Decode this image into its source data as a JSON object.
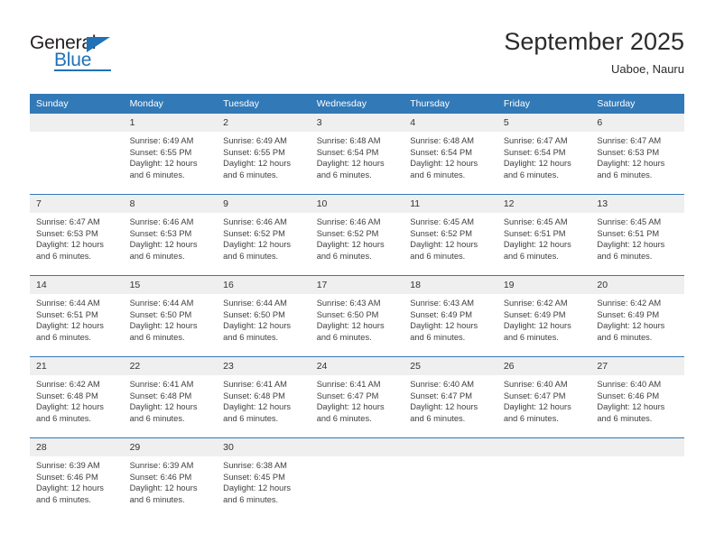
{
  "brand": {
    "name_top": "General",
    "name_bottom": "Blue",
    "logo_icon": "triangle-icon",
    "accent_color": "#1f72b8"
  },
  "header": {
    "title": "September 2025",
    "subtitle": "Uaboe, Nauru"
  },
  "theme": {
    "header_bg": "#3279b7",
    "daynum_bg": "#efefef",
    "rule_color": "#3279b7",
    "text_color": "#404040"
  },
  "calendar": {
    "weekday_headers": [
      "Sunday",
      "Monday",
      "Tuesday",
      "Wednesday",
      "Thursday",
      "Friday",
      "Saturday"
    ],
    "weeks": [
      [
        {
          "date": "",
          "sunrise": "",
          "sunset": "",
          "daylight": ""
        },
        {
          "date": "1",
          "sunrise": "Sunrise: 6:49 AM",
          "sunset": "Sunset: 6:55 PM",
          "daylight": "Daylight: 12 hours and 6 minutes."
        },
        {
          "date": "2",
          "sunrise": "Sunrise: 6:49 AM",
          "sunset": "Sunset: 6:55 PM",
          "daylight": "Daylight: 12 hours and 6 minutes."
        },
        {
          "date": "3",
          "sunrise": "Sunrise: 6:48 AM",
          "sunset": "Sunset: 6:54 PM",
          "daylight": "Daylight: 12 hours and 6 minutes."
        },
        {
          "date": "4",
          "sunrise": "Sunrise: 6:48 AM",
          "sunset": "Sunset: 6:54 PM",
          "daylight": "Daylight: 12 hours and 6 minutes."
        },
        {
          "date": "5",
          "sunrise": "Sunrise: 6:47 AM",
          "sunset": "Sunset: 6:54 PM",
          "daylight": "Daylight: 12 hours and 6 minutes."
        },
        {
          "date": "6",
          "sunrise": "Sunrise: 6:47 AM",
          "sunset": "Sunset: 6:53 PM",
          "daylight": "Daylight: 12 hours and 6 minutes."
        }
      ],
      [
        {
          "date": "7",
          "sunrise": "Sunrise: 6:47 AM",
          "sunset": "Sunset: 6:53 PM",
          "daylight": "Daylight: 12 hours and 6 minutes."
        },
        {
          "date": "8",
          "sunrise": "Sunrise: 6:46 AM",
          "sunset": "Sunset: 6:53 PM",
          "daylight": "Daylight: 12 hours and 6 minutes."
        },
        {
          "date": "9",
          "sunrise": "Sunrise: 6:46 AM",
          "sunset": "Sunset: 6:52 PM",
          "daylight": "Daylight: 12 hours and 6 minutes."
        },
        {
          "date": "10",
          "sunrise": "Sunrise: 6:46 AM",
          "sunset": "Sunset: 6:52 PM",
          "daylight": "Daylight: 12 hours and 6 minutes."
        },
        {
          "date": "11",
          "sunrise": "Sunrise: 6:45 AM",
          "sunset": "Sunset: 6:52 PM",
          "daylight": "Daylight: 12 hours and 6 minutes."
        },
        {
          "date": "12",
          "sunrise": "Sunrise: 6:45 AM",
          "sunset": "Sunset: 6:51 PM",
          "daylight": "Daylight: 12 hours and 6 minutes."
        },
        {
          "date": "13",
          "sunrise": "Sunrise: 6:45 AM",
          "sunset": "Sunset: 6:51 PM",
          "daylight": "Daylight: 12 hours and 6 minutes."
        }
      ],
      [
        {
          "date": "14",
          "sunrise": "Sunrise: 6:44 AM",
          "sunset": "Sunset: 6:51 PM",
          "daylight": "Daylight: 12 hours and 6 minutes."
        },
        {
          "date": "15",
          "sunrise": "Sunrise: 6:44 AM",
          "sunset": "Sunset: 6:50 PM",
          "daylight": "Daylight: 12 hours and 6 minutes."
        },
        {
          "date": "16",
          "sunrise": "Sunrise: 6:44 AM",
          "sunset": "Sunset: 6:50 PM",
          "daylight": "Daylight: 12 hours and 6 minutes."
        },
        {
          "date": "17",
          "sunrise": "Sunrise: 6:43 AM",
          "sunset": "Sunset: 6:50 PM",
          "daylight": "Daylight: 12 hours and 6 minutes."
        },
        {
          "date": "18",
          "sunrise": "Sunrise: 6:43 AM",
          "sunset": "Sunset: 6:49 PM",
          "daylight": "Daylight: 12 hours and 6 minutes."
        },
        {
          "date": "19",
          "sunrise": "Sunrise: 6:42 AM",
          "sunset": "Sunset: 6:49 PM",
          "daylight": "Daylight: 12 hours and 6 minutes."
        },
        {
          "date": "20",
          "sunrise": "Sunrise: 6:42 AM",
          "sunset": "Sunset: 6:49 PM",
          "daylight": "Daylight: 12 hours and 6 minutes."
        }
      ],
      [
        {
          "date": "21",
          "sunrise": "Sunrise: 6:42 AM",
          "sunset": "Sunset: 6:48 PM",
          "daylight": "Daylight: 12 hours and 6 minutes."
        },
        {
          "date": "22",
          "sunrise": "Sunrise: 6:41 AM",
          "sunset": "Sunset: 6:48 PM",
          "daylight": "Daylight: 12 hours and 6 minutes."
        },
        {
          "date": "23",
          "sunrise": "Sunrise: 6:41 AM",
          "sunset": "Sunset: 6:48 PM",
          "daylight": "Daylight: 12 hours and 6 minutes."
        },
        {
          "date": "24",
          "sunrise": "Sunrise: 6:41 AM",
          "sunset": "Sunset: 6:47 PM",
          "daylight": "Daylight: 12 hours and 6 minutes."
        },
        {
          "date": "25",
          "sunrise": "Sunrise: 6:40 AM",
          "sunset": "Sunset: 6:47 PM",
          "daylight": "Daylight: 12 hours and 6 minutes."
        },
        {
          "date": "26",
          "sunrise": "Sunrise: 6:40 AM",
          "sunset": "Sunset: 6:47 PM",
          "daylight": "Daylight: 12 hours and 6 minutes."
        },
        {
          "date": "27",
          "sunrise": "Sunrise: 6:40 AM",
          "sunset": "Sunset: 6:46 PM",
          "daylight": "Daylight: 12 hours and 6 minutes."
        }
      ],
      [
        {
          "date": "28",
          "sunrise": "Sunrise: 6:39 AM",
          "sunset": "Sunset: 6:46 PM",
          "daylight": "Daylight: 12 hours and 6 minutes."
        },
        {
          "date": "29",
          "sunrise": "Sunrise: 6:39 AM",
          "sunset": "Sunset: 6:46 PM",
          "daylight": "Daylight: 12 hours and 6 minutes."
        },
        {
          "date": "30",
          "sunrise": "Sunrise: 6:38 AM",
          "sunset": "Sunset: 6:45 PM",
          "daylight": "Daylight: 12 hours and 6 minutes."
        },
        {
          "date": "",
          "sunrise": "",
          "sunset": "",
          "daylight": ""
        },
        {
          "date": "",
          "sunrise": "",
          "sunset": "",
          "daylight": ""
        },
        {
          "date": "",
          "sunrise": "",
          "sunset": "",
          "daylight": ""
        },
        {
          "date": "",
          "sunrise": "",
          "sunset": "",
          "daylight": ""
        }
      ]
    ]
  }
}
